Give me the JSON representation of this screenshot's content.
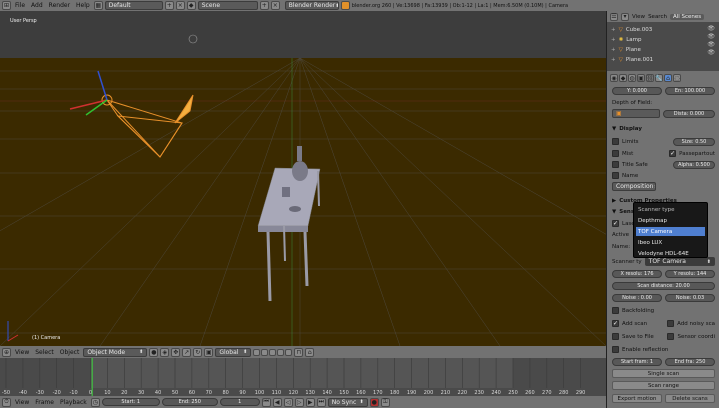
{
  "top_menu": {
    "items": [
      "File",
      "Add",
      "Render",
      "Help"
    ],
    "layout": "Default",
    "scene": "Scene",
    "engine": "Blender Render",
    "info": "blender.org 260 | Ve:13698 | Fa:13939 | Ob:1-12 | La:1 | Mem:6.50M (0.10M) | Camera"
  },
  "viewport": {
    "view_label": "User Persp",
    "object_label": "(1) Camera"
  },
  "viewport_header": {
    "menus": [
      "View",
      "Select",
      "Object"
    ],
    "mode": "Object Mode",
    "orientation": "Global"
  },
  "outliner": {
    "header_items": [
      "View",
      "Search",
      "All Scenes"
    ],
    "items": [
      "Cube.003",
      "Lamp",
      "Plane",
      "Plane.001"
    ]
  },
  "props": {
    "y_value": "Y: 0.000",
    "end_value": "En: 100.000",
    "depth_of_field": "Depth of Field:",
    "distance": "Dista: 0.000",
    "display_section": "Display",
    "limits": "Limits",
    "size": "Size: 0.50",
    "mist": "Mist",
    "passepartout": "Passepartout",
    "title_safe": "Title Safe",
    "alpha": "Alpha: 0.500",
    "name": "Name",
    "composition": "Composition",
    "custom_properties": "Custom Properties",
    "sensor_section": "Sens",
    "laser_label": "Lase",
    "active_label": "Active",
    "name_label": "Name:",
    "scanner_type_label": "Scanner ty",
    "scanner_type_value": "TOF Camera",
    "x_resolution": "X resolu: 176",
    "y_resolution": "Y resolu: 144",
    "scan_distance": "Scan distance: 20.00",
    "noise1": "Noise : 0.00",
    "noise2": "Noise: 0.03",
    "backfolding": "Backfolding",
    "add_scan": "Add scan",
    "add_noisy_scan": "Add noisy sca",
    "save_to_file": "Save to File",
    "sensor_coordinates": "Sensor coordi",
    "enable_reflection": "Enable reflection",
    "start_frame": "Start fram: 1",
    "end_frame": "End fra: 250",
    "single_scan": "Single scan",
    "scan_range": "Scan range",
    "export_motion": "Export motion",
    "delete_scans": "Delete scans"
  },
  "popup": {
    "title": "Scanner type",
    "items": [
      "Depthmap",
      "TOF Camera",
      "Ibeo LUX",
      "Velodyne HDL-64E"
    ],
    "active_index": 1
  },
  "timeline": {
    "ticks": [
      "-50",
      "-40",
      "-30",
      "-20",
      "-10",
      "0",
      "10",
      "20",
      "30",
      "40",
      "50",
      "60",
      "70",
      "80",
      "90",
      "100",
      "110",
      "120",
      "130",
      "140",
      "150",
      "160",
      "170",
      "180",
      "190",
      "200",
      "210",
      "220",
      "230",
      "240",
      "250",
      "260",
      "270",
      "280",
      "290"
    ],
    "current_frame": 1
  },
  "timeline_header": {
    "menus": [
      "View",
      "Frame",
      "Playback"
    ],
    "start": "Start: 1",
    "end": "End: 250",
    "current": "1",
    "sync": "No Sync"
  },
  "colors": {
    "grid_bg": "#3d3d3d",
    "ground": "#3b2a00",
    "camera_wire": "#e8902a",
    "axis_x": "#d03030",
    "axis_y": "#30c030",
    "axis_z": "#3050d0",
    "popup_active": "#4f7fd0"
  }
}
